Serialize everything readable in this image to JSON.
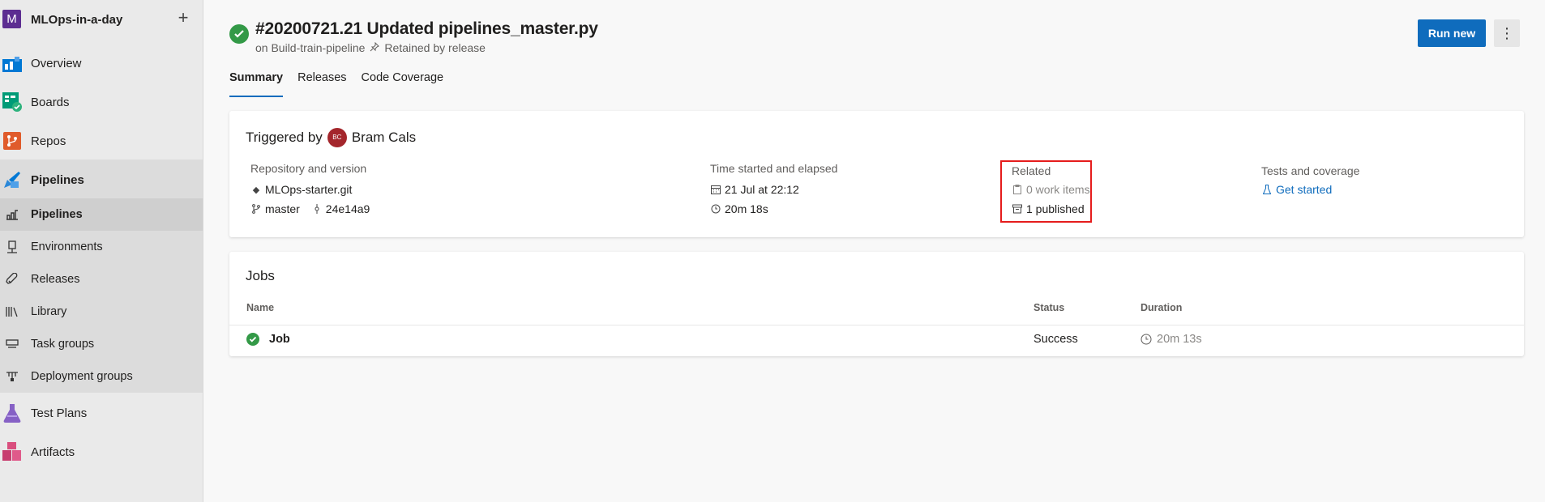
{
  "sidebar": {
    "project": {
      "initial": "M",
      "name": "MLOps-in-a-day",
      "avatar_color": "#5c2d91"
    },
    "items": [
      {
        "label": "Overview",
        "icon": "overview-icon",
        "color": "#0078d4"
      },
      {
        "label": "Boards",
        "icon": "boards-icon",
        "color": "#009b77"
      },
      {
        "label": "Repos",
        "icon": "repos-icon",
        "color": "#e05b2b"
      },
      {
        "label": "Pipelines",
        "icon": "pipelines-icon",
        "color": "#0078d4"
      },
      {
        "label": "Test Plans",
        "icon": "test-plans-icon",
        "color": "#8661c5"
      },
      {
        "label": "Artifacts",
        "icon": "artifacts-icon",
        "color": "#c73e6f"
      }
    ],
    "pipelines_sub": [
      {
        "label": "Pipelines",
        "icon": "pipelines-sub-icon"
      },
      {
        "label": "Environments",
        "icon": "environments-icon"
      },
      {
        "label": "Releases",
        "icon": "releases-icon"
      },
      {
        "label": "Library",
        "icon": "library-icon"
      },
      {
        "label": "Task groups",
        "icon": "task-groups-icon"
      },
      {
        "label": "Deployment groups",
        "icon": "deployment-groups-icon"
      }
    ]
  },
  "header": {
    "title": "#20200721.21 Updated pipelines_master.py",
    "subtitle_pipeline": "on Build-train-pipeline",
    "subtitle_retained": "Retained by release",
    "run_new": "Run new",
    "more": "⋮"
  },
  "tabs": [
    "Summary",
    "Releases",
    "Code Coverage"
  ],
  "summary": {
    "triggered_by_label": "Triggered by",
    "user_initials": "BC",
    "user_name": "Bram Cals",
    "repo_header": "Repository and version",
    "repo_name": "MLOps-starter.git",
    "branch": "master",
    "commit": "24e14a9",
    "time_header": "Time started and elapsed",
    "started": "21 Jul at 22:12",
    "elapsed": "20m 18s",
    "related_header": "Related",
    "work_items": "0 work items",
    "published": "1 published",
    "tests_header": "Tests and coverage",
    "tests_link": "Get started"
  },
  "jobs": {
    "title": "Jobs",
    "columns": [
      "Name",
      "Status",
      "Duration"
    ],
    "rows": [
      {
        "name": "Job",
        "status": "Success",
        "duration": "20m 13s"
      }
    ]
  },
  "colors": {
    "accent": "#0f6cbd",
    "success": "#339947",
    "highlight": "#e51c1c"
  }
}
